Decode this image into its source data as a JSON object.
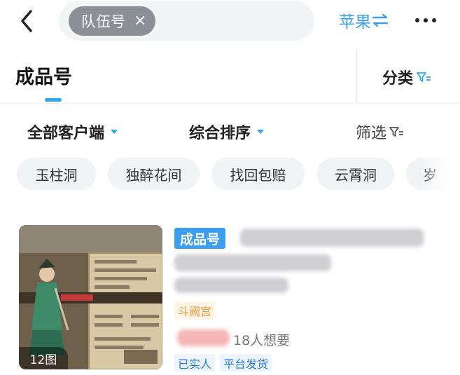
{
  "header": {
    "search_chip": "队伍号",
    "chip_close": "×",
    "platform_label": "苹果",
    "platform_switch_icon": "swap-arrows-icon",
    "colors": {
      "accent": "#2ea8f0",
      "chip": "#8b8f96"
    }
  },
  "tabs": {
    "active": "成品号",
    "category_label": "分类"
  },
  "filters": {
    "client": "全部客户端",
    "sort": "综合排序",
    "filter": "筛选"
  },
  "tags": [
    "玉柱洞",
    "独醉花间",
    "找回包赔",
    "云霄洞",
    "岁"
  ],
  "listing": {
    "type_badge": "成品号",
    "image_count": "12图",
    "server": "斗阙宫",
    "wants": "18人想要",
    "badges": [
      "已实人",
      "平台发货"
    ]
  }
}
